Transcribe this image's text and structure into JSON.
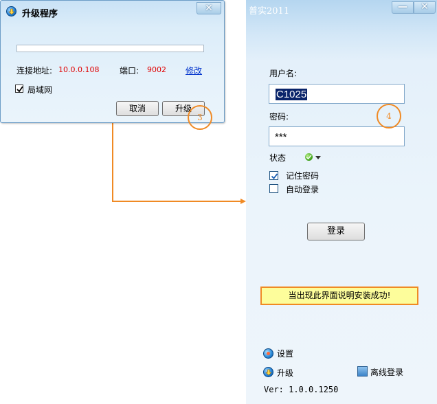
{
  "upgrade_dialog": {
    "title": "升级程序",
    "close_symbol": "✕",
    "progress": 0,
    "connection_label": "连接地址:",
    "connection_value": "10.0.0.108",
    "port_label": "端口:",
    "port_value": "9002",
    "modify_link": "修改",
    "lan_checked": true,
    "lan_label": "局域网",
    "cancel_button": "取消",
    "upgrade_button": "升级"
  },
  "annotations": {
    "circle_3": "3",
    "circle_4": "4",
    "accent_color": "#f08a24"
  },
  "login_window": {
    "title": "普实2011",
    "minimize_symbol": "—",
    "close_symbol": "✕",
    "username_label": "用户名:",
    "username_value": "C1025",
    "password_label": "密码:",
    "password_value": "***",
    "status_label": "状态",
    "remember_checked": true,
    "remember_label": "记住密码",
    "auto_login_checked": false,
    "auto_login_label": "自动登录",
    "login_button": "登录",
    "notice": "当出现此界面说明安装成功!",
    "settings_label": "设置",
    "upgrade_label": "升级",
    "offline_label": "离线登录",
    "version": "Ver: 1.0.0.1250"
  },
  "icons": {
    "app": "upgrade-icon",
    "status": "online-check-icon",
    "settings": "settings-icon",
    "offline": "offline-login-icon"
  }
}
